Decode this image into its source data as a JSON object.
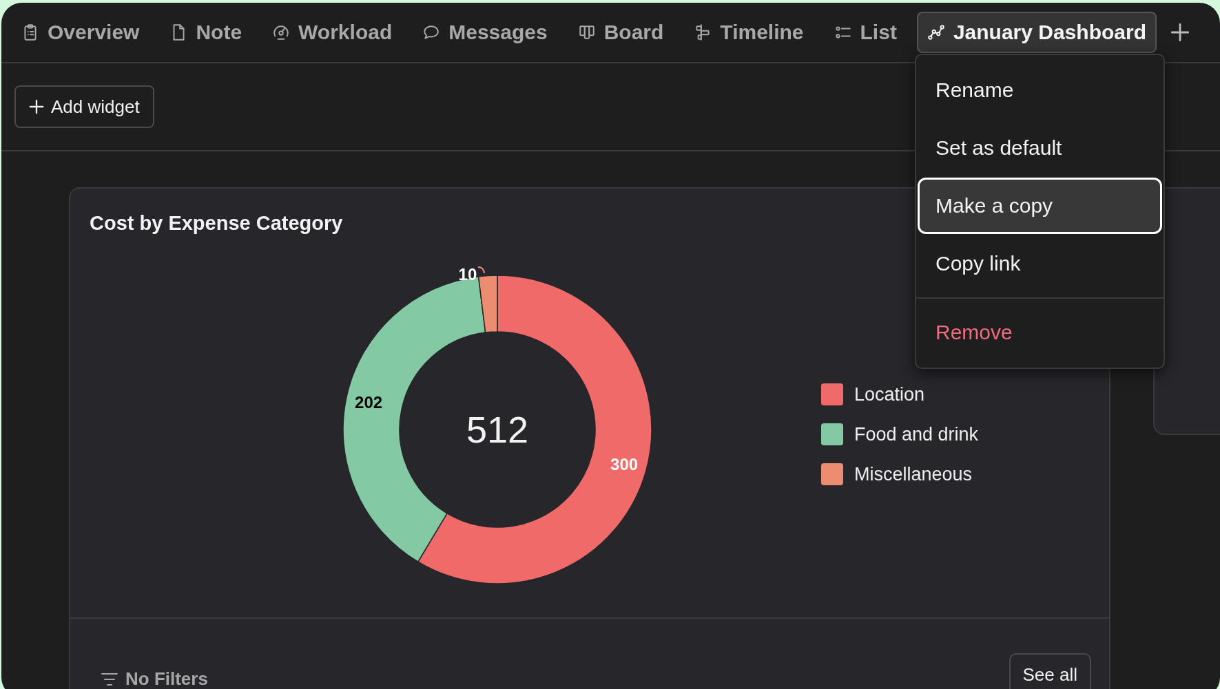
{
  "tabs": [
    {
      "label": "Overview",
      "selected": false
    },
    {
      "label": "Note",
      "selected": false
    },
    {
      "label": "Workload",
      "selected": false
    },
    {
      "label": "Messages",
      "selected": false
    },
    {
      "label": "Board",
      "selected": false
    },
    {
      "label": "Timeline",
      "selected": false
    },
    {
      "label": "List",
      "selected": false
    },
    {
      "label": "January Dashboard",
      "selected": true
    }
  ],
  "toolbar": {
    "add_widget": "Add widget"
  },
  "menu": {
    "items": [
      {
        "label": "Rename",
        "kind": "normal",
        "selected": false
      },
      {
        "label": "Set as default",
        "kind": "normal",
        "selected": false
      },
      {
        "label": "Make a copy",
        "kind": "normal",
        "selected": true
      },
      {
        "label": "Copy link",
        "kind": "normal",
        "selected": false
      },
      {
        "label": "Remove",
        "kind": "destructive",
        "selected": false
      }
    ]
  },
  "widget": {
    "title": "Cost by Expense Category",
    "total": "512",
    "chart_data": {
      "type": "donut",
      "categories": [
        "Location",
        "Food and drink",
        "Miscellaneous"
      ],
      "values": [
        300,
        202,
        10
      ],
      "colors": [
        "#f06a6a",
        "#83c9a4",
        "#ec8d71"
      ],
      "data_labels": true
    },
    "footer": {
      "filters": "No Filters",
      "see_all": "See all"
    }
  }
}
